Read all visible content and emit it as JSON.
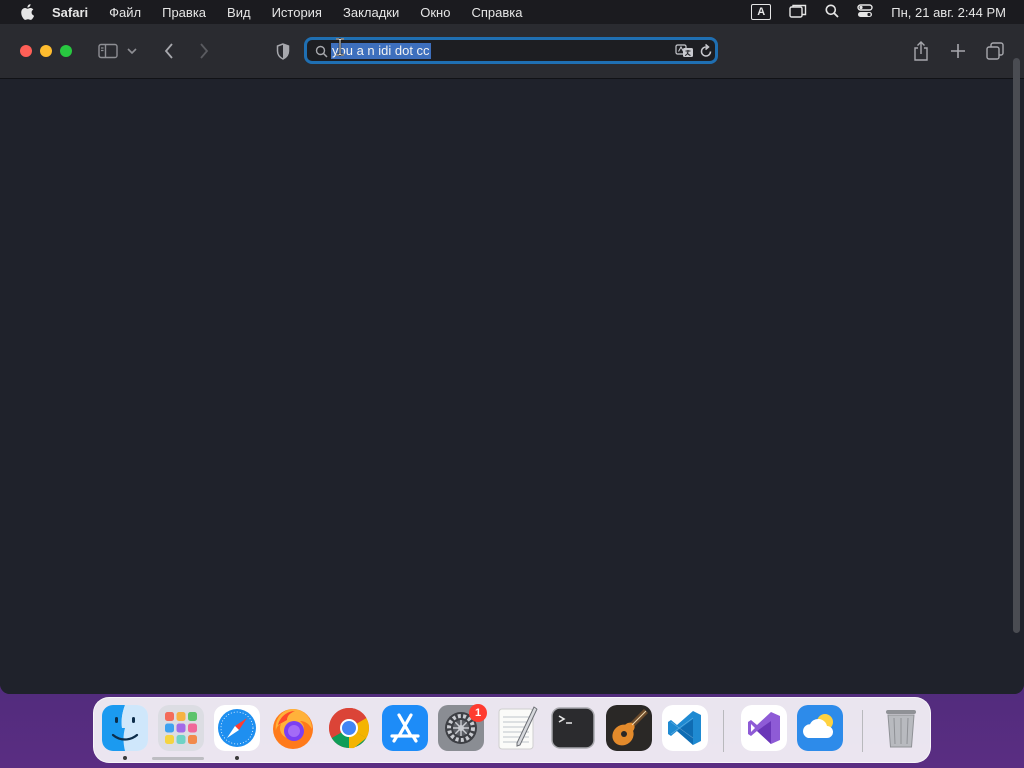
{
  "menubar": {
    "app_name": "Safari",
    "items": [
      "Файл",
      "Правка",
      "Вид",
      "История",
      "Закладки",
      "Окно",
      "Справка"
    ],
    "keyboard_layout": "A",
    "clock": "Пн, 21 авг.  2:44 PM"
  },
  "safari": {
    "address_text": "you a n idi dot cc",
    "accent_color": "#1f6fb2"
  },
  "dock": {
    "items": [
      {
        "name": "finder",
        "running": true
      },
      {
        "name": "launchpad",
        "running": false
      },
      {
        "name": "safari",
        "running": true
      },
      {
        "name": "firefox",
        "running": false
      },
      {
        "name": "chrome",
        "running": false
      },
      {
        "name": "app-store",
        "running": false
      },
      {
        "name": "system-settings",
        "running": false,
        "badge": "1"
      },
      {
        "name": "textedit",
        "running": false
      },
      {
        "name": "terminal",
        "running": false
      },
      {
        "name": "garageband",
        "running": false
      },
      {
        "name": "vscode",
        "running": false
      },
      {
        "name": "visual-studio",
        "running": false
      },
      {
        "name": "weather",
        "running": false
      },
      {
        "name": "trash",
        "running": false
      }
    ]
  }
}
